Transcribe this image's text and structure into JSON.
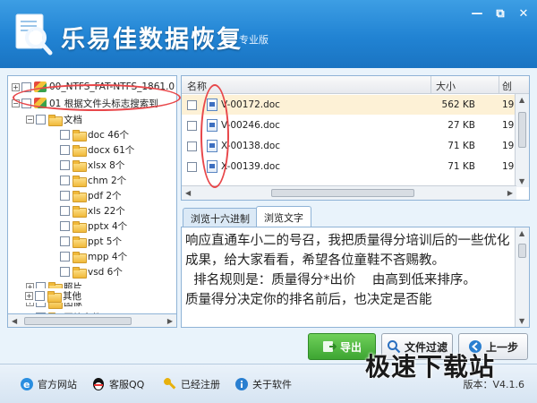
{
  "app": {
    "title": "乐易佳数据恢复",
    "edition": "专业版"
  },
  "window_buttons": {
    "minimize": "—",
    "restore": "⧉",
    "close": "✕"
  },
  "tree": {
    "items": [
      {
        "label": "00_NTFS_FAT-NTFS_1861.0",
        "type": "drive"
      },
      {
        "label": "01 根据文件头标志搜索到",
        "type": "drive"
      },
      {
        "label": "文档",
        "type": "folder"
      },
      {
        "label": "doc 46个",
        "type": "folder"
      },
      {
        "label": "docx 61个",
        "type": "folder"
      },
      {
        "label": "xlsx 8个",
        "type": "folder"
      },
      {
        "label": "chm 2个",
        "type": "folder"
      },
      {
        "label": "pdf 2个",
        "type": "folder"
      },
      {
        "label": "xls 22个",
        "type": "folder"
      },
      {
        "label": "pptx 4个",
        "type": "folder"
      },
      {
        "label": "ppt 5个",
        "type": "folder"
      },
      {
        "label": "mpp 4个",
        "type": "folder"
      },
      {
        "label": "vsd 6个",
        "type": "folder"
      },
      {
        "label": "照片",
        "type": "folder"
      },
      {
        "label": "图像",
        "type": "folder"
      },
      {
        "label": "压缩文件",
        "type": "folder"
      },
      {
        "label": "其他",
        "type": "folder"
      }
    ]
  },
  "file_list": {
    "columns": {
      "name": "名称",
      "size": "大小",
      "created": "创"
    },
    "rows": [
      {
        "name": "V-00172.doc",
        "size": "562 KB",
        "date": "19",
        "selected": true
      },
      {
        "name": "V-00246.doc",
        "size": "27 KB",
        "date": "19",
        "selected": false
      },
      {
        "name": "X-00138.doc",
        "size": "71 KB",
        "date": "19",
        "selected": false
      },
      {
        "name": "X-00139.doc",
        "size": "71 KB",
        "date": "19",
        "selected": false
      }
    ]
  },
  "tabs": {
    "hex": "浏览十六进制",
    "text": "浏览文字"
  },
  "preview": {
    "text": "响应直通车小二的号召，我把质量得分培训后的一些优化成果，给大家看看，希望各位童鞋不吝赐教。\n  排名规则是：质量得分*出价    由高到低来排序。\n质量得分决定你的排名前后，也决定是否能"
  },
  "buttons": {
    "export": "导出",
    "filter": "文件过滤",
    "back": "上一步"
  },
  "footer": {
    "site": "官方网站",
    "qq": "客服QQ",
    "registered": "已经注册",
    "about": "关于软件",
    "version": "版本：V4.1.6"
  },
  "watermark": "极速下载站",
  "colors": {
    "header": "#2183d3",
    "accent_green": "#3da532",
    "annotation": "#e8474a"
  }
}
